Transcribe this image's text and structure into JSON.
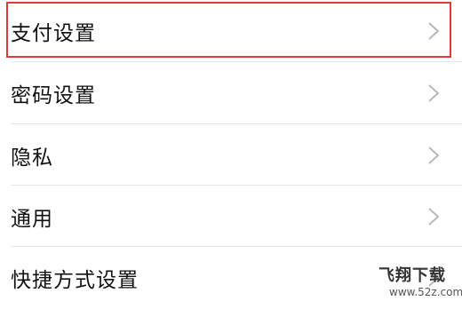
{
  "settings": {
    "items": [
      {
        "label": "支付设置",
        "highlighted": true
      },
      {
        "label": "密码设置"
      },
      {
        "label": "隐私"
      },
      {
        "label": "通用"
      },
      {
        "label": "快捷方式设置"
      }
    ],
    "highlight_color": "#e03a3a",
    "chevron_icon": "chevron-right-icon"
  },
  "watermark": {
    "brand": "飞翔下载",
    "url": "www.52z.com"
  }
}
